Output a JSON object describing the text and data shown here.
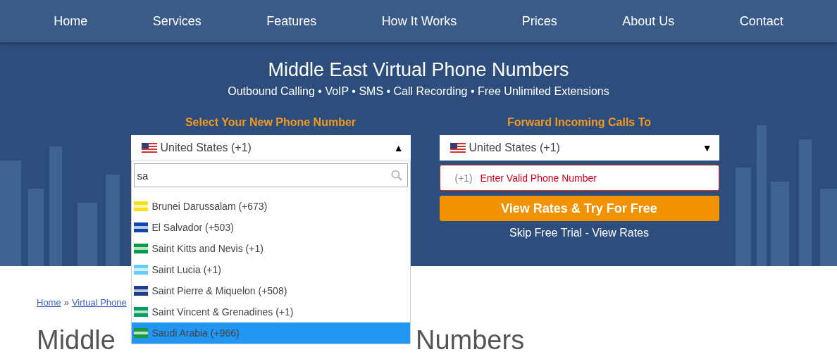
{
  "nav": {
    "items": [
      "Home",
      "Services",
      "Features",
      "How It Works",
      "Prices",
      "About Us",
      "Contact"
    ]
  },
  "hero": {
    "title": "Middle East Virtual Phone Numbers",
    "subtitle": "Outbound Calling • VoIP • SMS • Call Recording • Free Unlimited Extensions",
    "select_number": {
      "label": "Select Your New Phone Number",
      "value": "United States (+1)",
      "caret": "▲",
      "expanded": true,
      "search_value": "sa",
      "options": [
        {
          "label": "Brunei Darussalam (+673)",
          "color": "#f7e017",
          "selected": false
        },
        {
          "label": "El Salvador (+503)",
          "color": "#0f47af",
          "selected": false
        },
        {
          "label": "Saint Kitts and Nevis (+1)",
          "color": "#009e49",
          "selected": false
        },
        {
          "label": "Saint Lucia (+1)",
          "color": "#66ccff",
          "selected": false
        },
        {
          "label": "Saint Pierre & Miquelon (+508)",
          "color": "#1e3c8c",
          "selected": false
        },
        {
          "label": "Saint Vincent & Grenadines (+1)",
          "color": "#009e60",
          "selected": false
        },
        {
          "label": "Saudi Arabia (+966)",
          "color": "#1a9a3a",
          "selected": true
        }
      ]
    },
    "forward": {
      "label": "Forward Incoming Calls To",
      "value": "United States (+1)",
      "caret": "▼",
      "prefix": "(+1)",
      "placeholder": "Enter Valid Phone Number",
      "invalid": true
    },
    "cta": "View Rates & Try For Free",
    "skip_link": "Skip Free Trial - View Rates"
  },
  "breadcrumb": {
    "home": "Home",
    "separator": "»",
    "current": "Virtual Phone"
  },
  "page_title": {
    "start": "Middle",
    "end": "Numbers"
  }
}
